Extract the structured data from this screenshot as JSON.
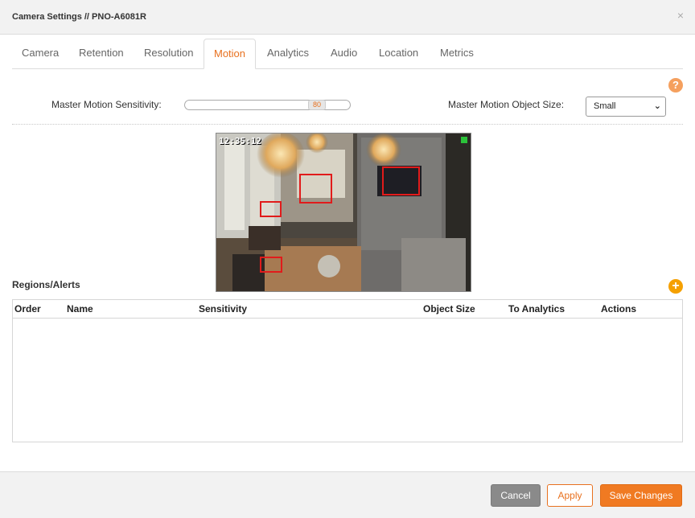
{
  "dialog": {
    "title": "Camera Settings // PNO-A6081R",
    "close_glyph": "×"
  },
  "tabs": [
    {
      "label": "Camera",
      "active": false
    },
    {
      "label": "Retention",
      "active": false
    },
    {
      "label": "Resolution",
      "active": false
    },
    {
      "label": "Motion",
      "active": true
    },
    {
      "label": "Analytics",
      "active": false
    },
    {
      "label": "Audio",
      "active": false
    },
    {
      "label": "Location",
      "active": false
    },
    {
      "label": "Metrics",
      "active": false
    }
  ],
  "help": {
    "glyph": "?",
    "icon": "help-icon"
  },
  "motion": {
    "sensitivity_label": "Master Motion Sensitivity:",
    "sensitivity_value": "80",
    "sensitivity_fraction": 0.8,
    "object_size_label": "Master Motion Object Size:",
    "object_size_value": "Small"
  },
  "preview": {
    "timestamp": "12:35:12"
  },
  "regions": {
    "title": "Regions/Alerts",
    "add_glyph": "+",
    "columns": [
      "Order",
      "Name",
      "Sensitivity",
      "Object Size",
      "To Analytics",
      "Actions"
    ],
    "rows": []
  },
  "footer": {
    "cancel_label": "Cancel",
    "apply_label": "Apply",
    "save_label": "Save Changes"
  },
  "colors": {
    "accent": "#e8711f",
    "motion_box": "#e11b1b",
    "add_icon": "#f5a000"
  }
}
